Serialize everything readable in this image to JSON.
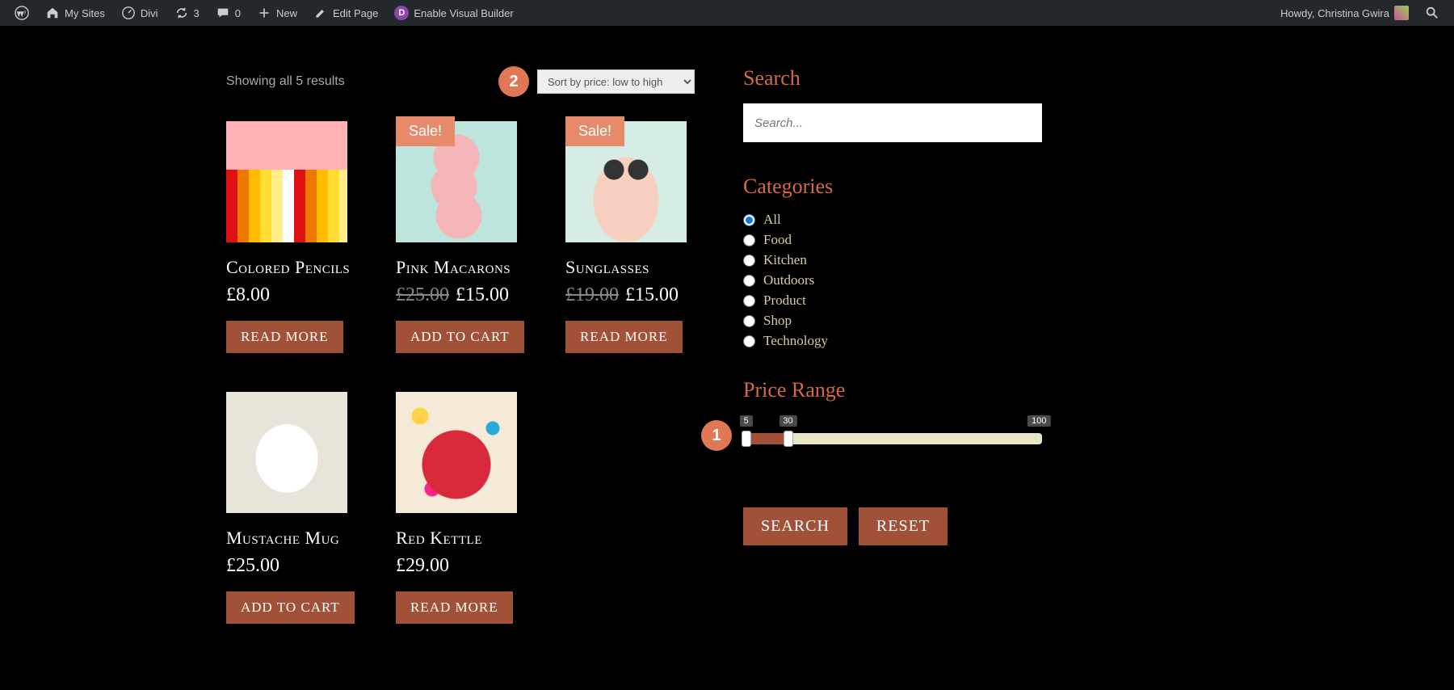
{
  "adminbar": {
    "mysites": "My Sites",
    "site": "Divi",
    "updates": "3",
    "comments": "0",
    "new": "New",
    "editpage": "Edit Page",
    "visualbuilder": "Enable Visual Builder",
    "howdy": "Howdy, Christina Gwira"
  },
  "results": "Showing all 5 results",
  "badges": {
    "one": "1",
    "two": "2"
  },
  "sort": {
    "selected": "Sort by price: low to high"
  },
  "sale_label": "Sale!",
  "products": [
    {
      "title": "Colored Pencils",
      "price": "£8.00",
      "old": "",
      "btn": "READ MORE",
      "sale": false,
      "img": "t-pencils"
    },
    {
      "title": "Pink Macarons",
      "price": "£15.00",
      "old": "£25.00",
      "btn": "ADD TO CART",
      "sale": true,
      "img": "t-macarons"
    },
    {
      "title": "Sunglasses",
      "price": "£15.00",
      "old": "£19.00",
      "btn": "READ MORE",
      "sale": true,
      "img": "t-sunglasses"
    },
    {
      "title": "Mustache Mug",
      "price": "£25.00",
      "old": "",
      "btn": "ADD TO CART",
      "sale": false,
      "img": "t-mug"
    },
    {
      "title": "Red Kettle",
      "price": "£29.00",
      "old": "",
      "btn": "READ MORE",
      "sale": false,
      "img": "t-kettle"
    }
  ],
  "sidebar": {
    "search_h": "Search",
    "search_ph": "Search...",
    "cat_h": "Categories",
    "categories": [
      "All",
      "Food",
      "Kitchen",
      "Outdoors",
      "Product",
      "Shop",
      "Technology"
    ],
    "price_h": "Price Range",
    "range": {
      "min": "5",
      "low_handle": "5",
      "high_handle": "30",
      "max": "100"
    },
    "searchbtn": "SEARCH",
    "resetbtn": "RESET"
  }
}
